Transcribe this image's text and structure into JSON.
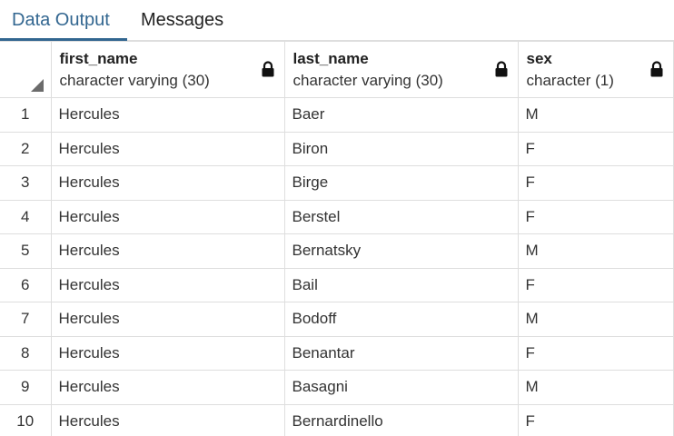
{
  "tabs": [
    {
      "label": "Data Output",
      "active": true
    },
    {
      "label": "Messages",
      "active": false
    }
  ],
  "columns": [
    {
      "name": "first_name",
      "type": "character varying (30)",
      "icon": "lock-icon"
    },
    {
      "name": "last_name",
      "type": "character varying (30)",
      "icon": "lock-icon"
    },
    {
      "name": "sex",
      "type": "character (1)",
      "icon": "lock-icon"
    }
  ],
  "rows": [
    {
      "num": "1",
      "first_name": "Hercules",
      "last_name": "Baer",
      "sex": "M"
    },
    {
      "num": "2",
      "first_name": "Hercules",
      "last_name": "Biron",
      "sex": "F"
    },
    {
      "num": "3",
      "first_name": "Hercules",
      "last_name": "Birge",
      "sex": "F"
    },
    {
      "num": "4",
      "first_name": "Hercules",
      "last_name": "Berstel",
      "sex": "F"
    },
    {
      "num": "5",
      "first_name": "Hercules",
      "last_name": "Bernatsky",
      "sex": "M"
    },
    {
      "num": "6",
      "first_name": "Hercules",
      "last_name": "Bail",
      "sex": "F"
    },
    {
      "num": "7",
      "first_name": "Hercules",
      "last_name": "Bodoff",
      "sex": "M"
    },
    {
      "num": "8",
      "first_name": "Hercules",
      "last_name": "Benantar",
      "sex": "F"
    },
    {
      "num": "9",
      "first_name": "Hercules",
      "last_name": "Basagni",
      "sex": "M"
    },
    {
      "num": "10",
      "first_name": "Hercules",
      "last_name": "Bernardinello",
      "sex": "F"
    }
  ],
  "colors": {
    "accent": "#326690",
    "grid_border": "#dedede"
  }
}
